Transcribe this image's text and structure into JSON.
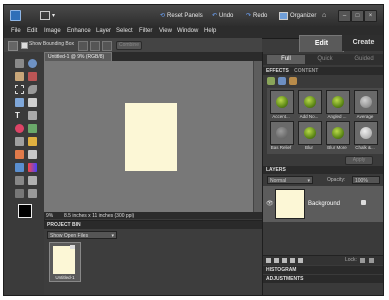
{
  "titlebar": {
    "panels_button": "Reset Panels",
    "undo_button": "Undo",
    "redo_button": "Redo",
    "organizer_button": "Organizer"
  },
  "menu": [
    "File",
    "Edit",
    "Image",
    "Enhance",
    "Layer",
    "Select",
    "Filter",
    "View",
    "Window",
    "Help"
  ],
  "options": {
    "show_bounding_box": "Show Bounding Box",
    "transform_label": "Combine"
  },
  "modes": {
    "edit": "Edit",
    "create": "Create"
  },
  "subtabs": [
    "Full",
    "Quick",
    "Guided"
  ],
  "document": {
    "tab_title": "Untitled-1 @ 9% (RGB/8)",
    "zoom": "9%",
    "doc_info": "8.5 inches x 11 inches (300 ppi)"
  },
  "project_bin": {
    "header": "PROJECT BIN",
    "filter": "Show Open Files",
    "item_label": "Untitled-1"
  },
  "effects": {
    "header": "EFFECTS",
    "tab2": "CONTENT",
    "items": [
      "Accent...",
      "Add No...",
      "Angled ...",
      "Average",
      "Bas Relief",
      "Blur",
      "Blur More",
      "Chalk &..."
    ],
    "apply": "Apply"
  },
  "layers": {
    "header": "LAYERS",
    "blend": "Normal",
    "opacity_label": "Opacity:",
    "opacity_value": "100%",
    "layer_name": "Background",
    "lock_label": "Lock:"
  },
  "histogram": {
    "header": "HISTOGRAM"
  },
  "adjustments": {
    "header": "ADJUSTMENTS"
  },
  "colors": {
    "canvas": "#fcf7d6",
    "accent": "#2f6fb8"
  }
}
